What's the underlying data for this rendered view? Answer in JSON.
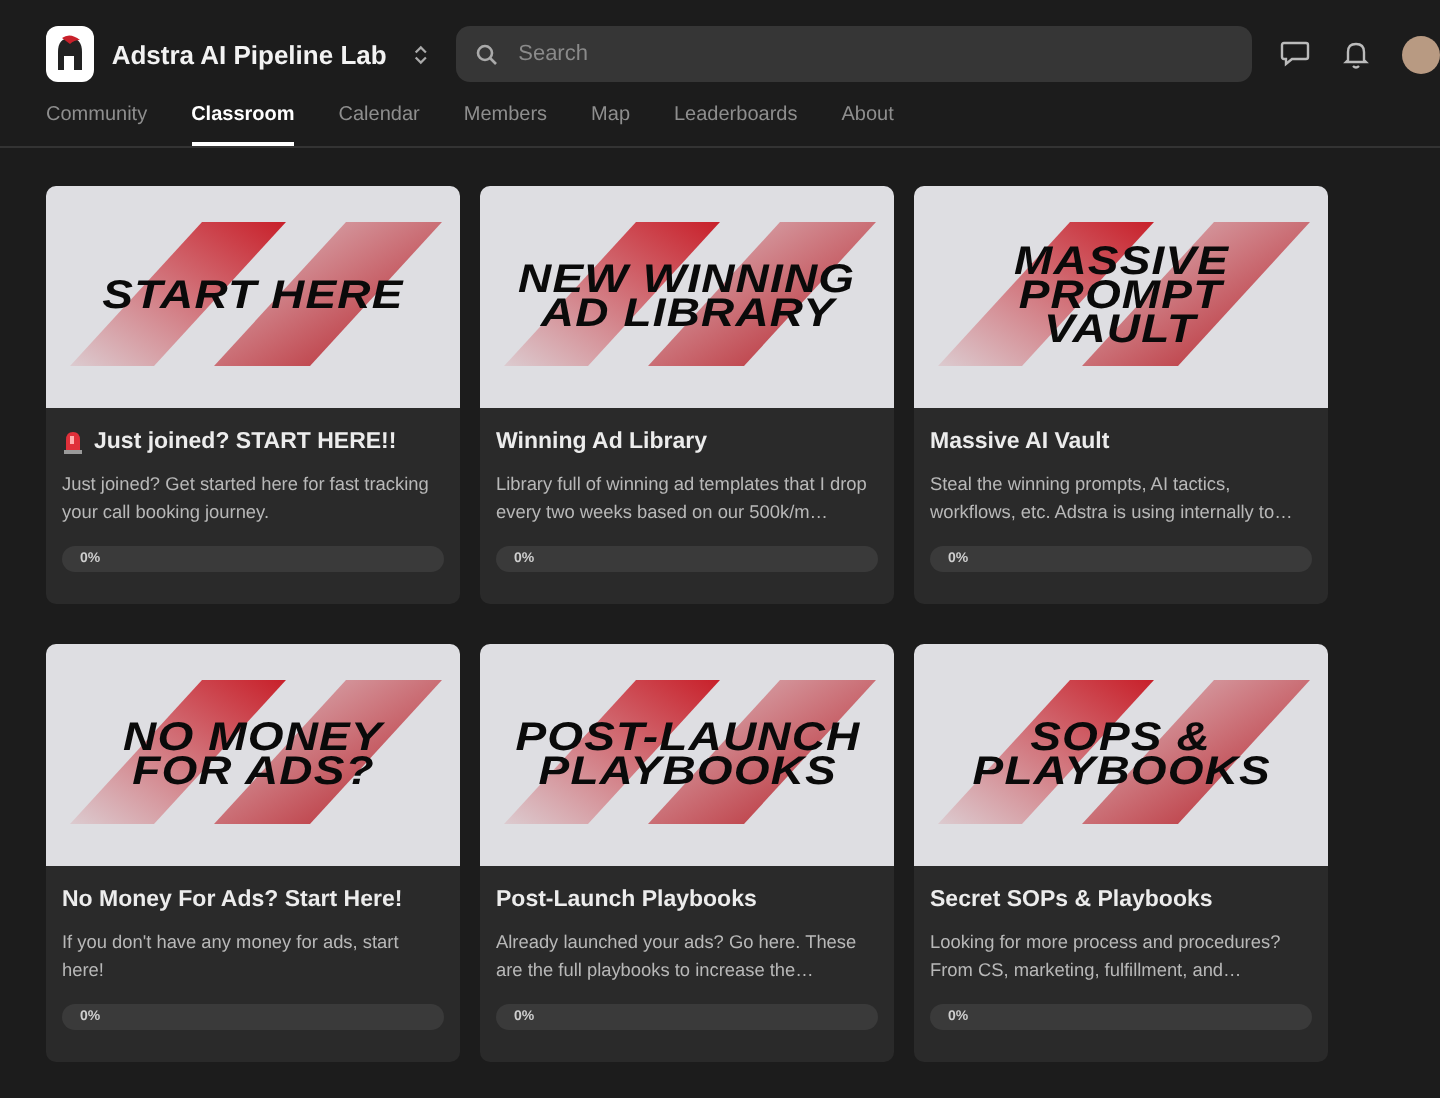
{
  "header": {
    "group_name": "Adstra AI Pipeline Lab",
    "search": {
      "placeholder": "Search"
    }
  },
  "tabs": [
    {
      "label": "Community",
      "selected": false
    },
    {
      "label": "Classroom",
      "selected": true
    },
    {
      "label": "Calendar",
      "selected": false
    },
    {
      "label": "Members",
      "selected": false
    },
    {
      "label": "Map",
      "selected": false
    },
    {
      "label": "Leaderboards",
      "selected": false
    },
    {
      "label": "About",
      "selected": false
    }
  ],
  "courses": [
    {
      "thumbnail_text": [
        "START HERE"
      ],
      "alert_icon": true,
      "title": "Just joined? START HERE!!",
      "description": "Just joined? Get started here for fast tracking your call booking journey.",
      "level": 0,
      "progress": "0%"
    },
    {
      "thumbnail_text": [
        "NEW WINNING",
        "AD LIBRARY"
      ],
      "alert_icon": false,
      "title": "Winning Ad Library",
      "description": "Library full of winning ad templates that I drop every two weeks based on our 500k/m…",
      "level": 0,
      "progress": "0%"
    },
    {
      "thumbnail_text": [
        "MASSIVE",
        "PROMPT",
        "VAULT"
      ],
      "alert_icon": false,
      "title": "Massive AI Vault",
      "description": "Steal the winning prompts, AI tactics, workflows, etc. Adstra is using internally to…",
      "level": 0,
      "progress": "0%"
    },
    {
      "thumbnail_text": [
        "NO MONEY",
        "FOR ADS?"
      ],
      "alert_icon": false,
      "title": "No Money For Ads? Start Here!",
      "description": "If you don't have any money for ads, start here!",
      "level": 0,
      "progress": "0%"
    },
    {
      "thumbnail_text": [
        "POST-LAUNCH",
        "PLAYBOOKS"
      ],
      "alert_icon": false,
      "title": "Post-Launch Playbooks",
      "description": "Already launched your ads? Go here. These are the full playbooks to increase the…",
      "level": 0,
      "progress": "0%"
    },
    {
      "thumbnail_text": [
        "SOPS &",
        "PLAYBOOKS"
      ],
      "alert_icon": false,
      "title": "Secret SOPs & Playbooks",
      "description": "Looking for more process and procedures? From CS, marketing, fulfillment, and…",
      "level": 0,
      "progress": "0%"
    }
  ]
}
